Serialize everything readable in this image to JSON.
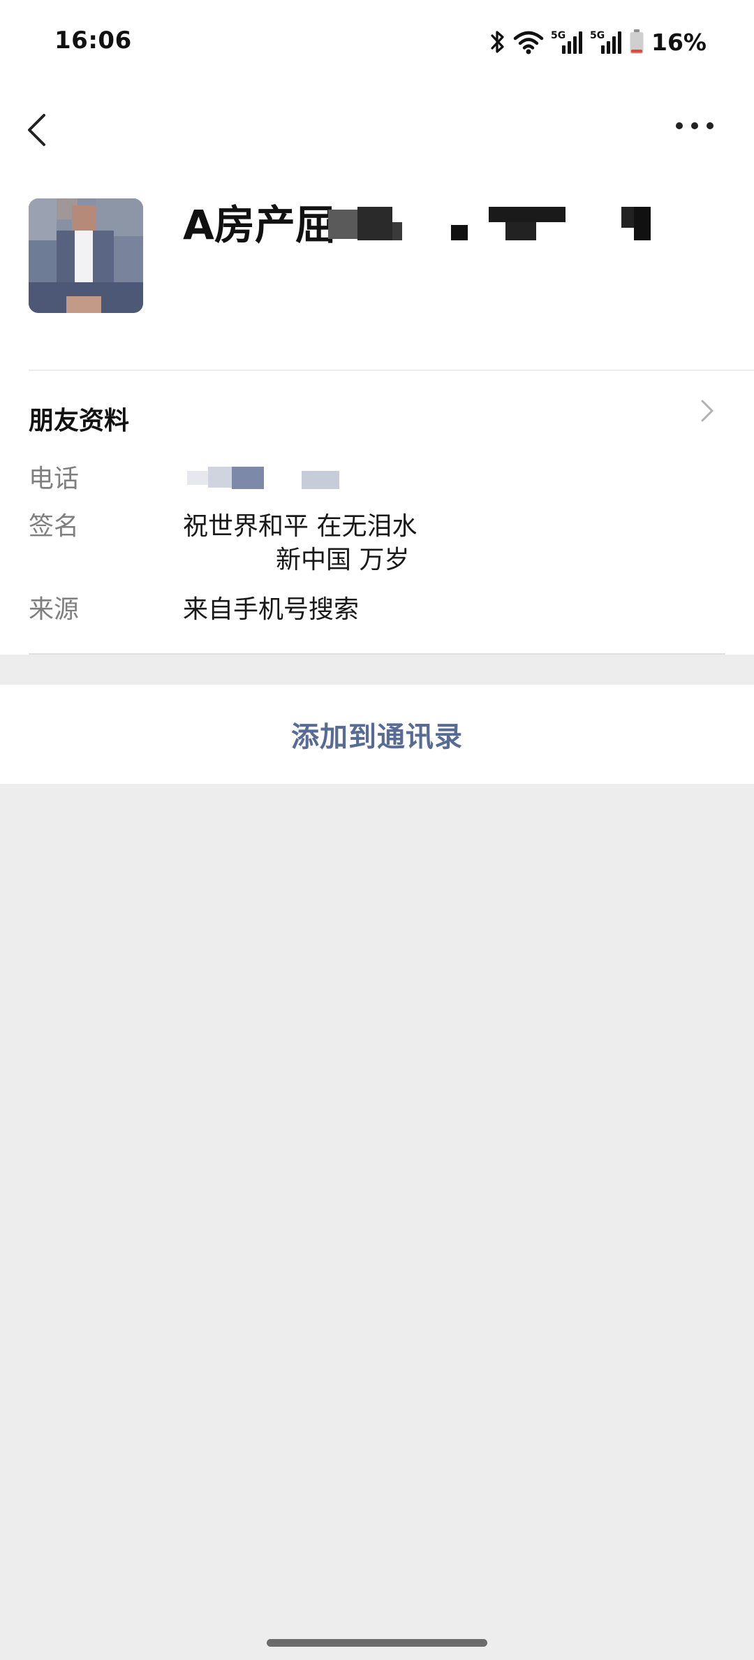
{
  "status_bar": {
    "time": "16:06",
    "battery_percent": "16%",
    "battery_level": 0.16,
    "network_1": "5G",
    "network_2": "5G",
    "icons": [
      "bluetooth-icon",
      "wifi-icon",
      "signal-5g-icon",
      "signal-5g-icon",
      "battery-icon"
    ]
  },
  "nav": {
    "back_icon": "chevron-left-icon",
    "more_icon": "more-horizontal-icon"
  },
  "profile": {
    "name": "A房产屈"
  },
  "friend_info": {
    "title": "朋友资料",
    "phone_label": "电话",
    "signature_label": "签名",
    "signature_line1": "祝世界和平 在无泪水",
    "signature_line2": "新中国 万岁",
    "source_label": "来源",
    "source_value": "来自手机号搜索"
  },
  "actions": {
    "add_to_contacts": "添加到通讯录"
  },
  "colors": {
    "link_blue": "#576b95",
    "background": "#ededed",
    "card": "#ffffff",
    "battery_low": "#e5483d"
  }
}
